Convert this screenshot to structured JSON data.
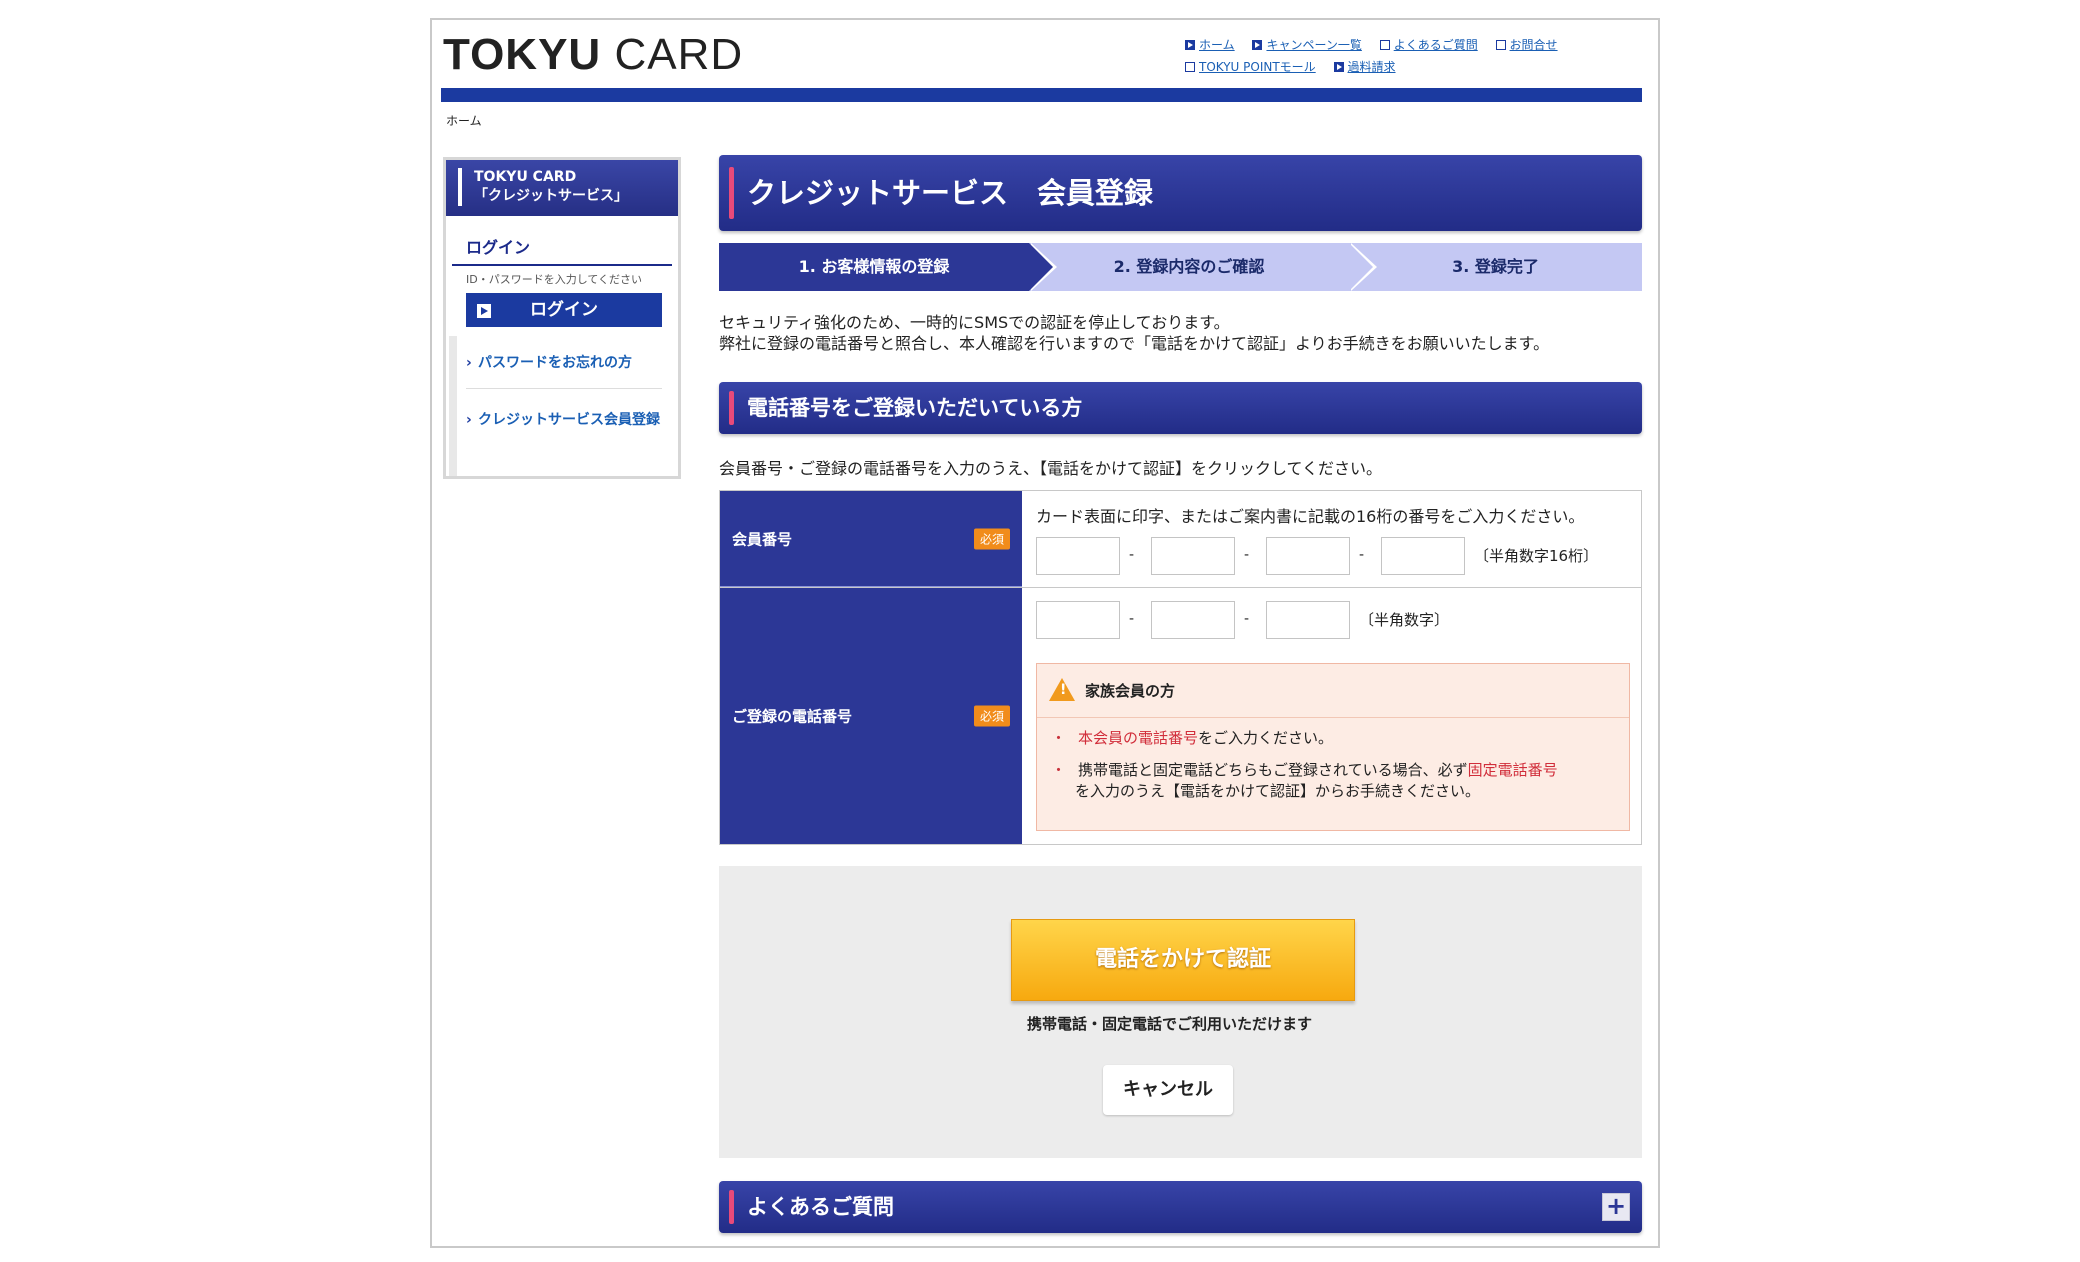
{
  "header": {
    "logo_bold": "TOKYU",
    "logo_light": "CARD",
    "links": [
      {
        "label": "ホーム",
        "icon": "arrow-square-icon"
      },
      {
        "label": "キャンペーン一覧",
        "icon": "arrow-square-icon"
      },
      {
        "label": "よくあるご質問",
        "icon": "new-window-icon"
      },
      {
        "label": "お問合せ",
        "icon": "new-window-icon"
      },
      {
        "label": "TOKYU POINTモール",
        "icon": "new-window-icon"
      },
      {
        "label": "過料請求",
        "icon": "arrow-square-icon"
      }
    ]
  },
  "breadcrumb": "ホーム",
  "sidebar": {
    "head_line1": "TOKYU CARD",
    "head_line2": "「クレジットサービス」",
    "login_title": "ログイン",
    "login_hint": "ID・パスワードを入力してください",
    "login_button": "ログイン",
    "link_forgot": "パスワードをお忘れの方",
    "link_register": "クレジットサービス会員登録"
  },
  "main": {
    "title": "クレジットサービス　会員登録",
    "steps": [
      "1. お客様情報の登録",
      "2. 登録内容のご確認",
      "3. 登録完了"
    ],
    "notice_line1": "セキュリティ強化のため、一時的にSMSでの認証を停止しております。",
    "notice_line2": "弊社に登録の電話番号と照合し、本人確認を行いますので「電話をかけて認証」よりお手続きをお願いいたします。",
    "section_title": "電話番号をご登録いただいている方",
    "instruction": "会員番号・ご登録の電話番号を入力のうえ、【電話をかけて認証】をクリックしてください。"
  },
  "form": {
    "required_badge": "必須",
    "member_label": "会員番号",
    "member_desc": "カード表面に印字、またはご案内書に記載の16桁の番号をご入力ください。",
    "member_hint": "〔半角数字16桁〕",
    "member_values": [
      "",
      "",
      "",
      ""
    ],
    "phone_label": "ご登録の電話番号",
    "phone_hint": "〔半角数字〕",
    "phone_values": [
      "",
      "",
      ""
    ],
    "dash": "-",
    "family": {
      "title": "家族会員の方",
      "bullet": "・",
      "item1_red": "本会員の電話番号",
      "item1_rest": "をご入力ください。",
      "item2_pre": "携帯電話と固定電話どちらもご登録されている場合、必ず",
      "item2_red": "固定電話番号",
      "item2_rest": "を入力のうえ【電話をかけて認証】からお手続きください。"
    }
  },
  "actions": {
    "call_button": "電話をかけて認証",
    "call_sub": "携帯電話・固定電話でご利用いただけます",
    "cancel_button": "キャンセル"
  },
  "faq": {
    "title": "よくあるご質問",
    "toggle": "+"
  },
  "colors": {
    "navy": "#2c3796",
    "brand_blue": "#1b3aa0",
    "accent_pink": "#e84a7a",
    "orange": "#f7a90f",
    "required_orange": "#f18c1b",
    "alert_red": "#d12d3a"
  }
}
